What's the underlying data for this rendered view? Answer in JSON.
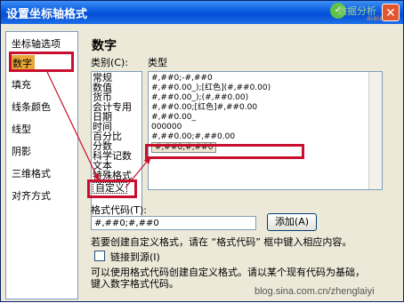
{
  "window": {
    "title": "设置坐标轴格式",
    "close_icon": "✕",
    "watermark": {
      "icon": "logo-circle-icon",
      "text": "数据分析",
      "sub": "aiaia"
    }
  },
  "sidebar": {
    "items": [
      {
        "label": "坐标轴选项",
        "selected": false
      },
      {
        "label": "数字",
        "selected": true
      },
      {
        "label": "填充",
        "selected": false
      },
      {
        "label": "线条颜色",
        "selected": false
      },
      {
        "label": "线型",
        "selected": false
      },
      {
        "label": "阴影",
        "selected": false
      },
      {
        "label": "三维格式",
        "selected": false
      },
      {
        "label": "对齐方式",
        "selected": false
      }
    ]
  },
  "panel": {
    "title": "数字",
    "category_label": "类别(C):",
    "type_label": "类型",
    "categories": [
      "常规",
      "数值",
      "货币",
      "会计专用",
      "日期",
      "时间",
      "百分比",
      "分数",
      "科学记数",
      "文本",
      "特殊格式",
      "自定义"
    ],
    "selected_category": "自定义",
    "types": [
      "#,##0;-#,##0",
      "#,##0.00_);[红色](#,##0.00)",
      "#,##0.00_);(#,##0.00)",
      "#,##0.00;[红色]#,##0.00",
      "#,##0.00_",
      "000000",
      "#,##0.00;#,##0.00",
      "#,##0;#,##0"
    ],
    "selected_type": "#,##0;#,##0",
    "format_code_label": "格式代码(T):",
    "format_code_value": "#,##0;#,##0",
    "add_button": "添加(A)",
    "help_text": "若要创建自定义格式，请在 “格式代码” 框中键入相应内容。",
    "link_label": "链接到源(I)",
    "link_checked": false,
    "desc_line1": "可以使用格式代码创建自定义格式。请以某个现有代码为基础，",
    "desc_line2": "键入数字格式代码。"
  },
  "watermark_url": "blog.sina.com.cn/zhenglaiyi",
  "colors": {
    "titlebar": "#0a5be0",
    "highlight": "#c8102e",
    "selected_nav": "#e8a73a"
  }
}
